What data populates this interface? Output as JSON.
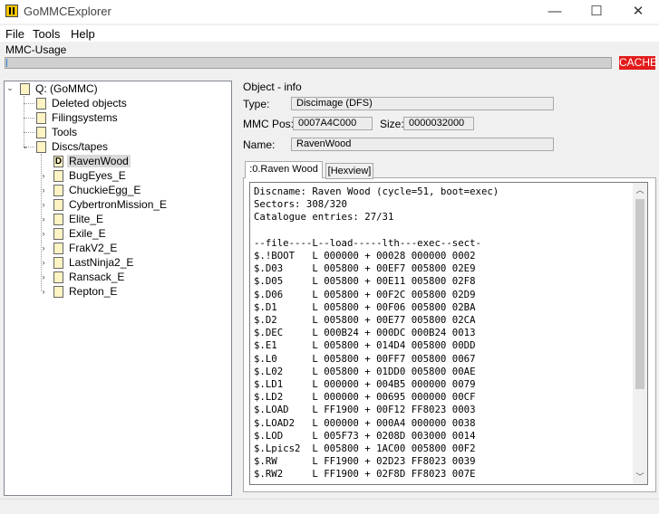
{
  "window": {
    "title": "GoMMCExplorer",
    "controls": [
      "—",
      "☐",
      "✕"
    ]
  },
  "menu": [
    "File",
    "Tools",
    "Help"
  ],
  "usage": {
    "label": "MMC-Usage",
    "fill_fraction": 0.002,
    "cache_label": "CACHE",
    "accent": "#2a7fd4",
    "cache_color": "#e21b1b"
  },
  "tree": {
    "root": "Q: (GoMMC)",
    "top_items": [
      "Deleted objects",
      "Filingsystems",
      "Tools",
      "Discs/tapes"
    ],
    "discs": [
      "RavenWood",
      "BugEyes_E",
      "ChuckieEgg_E",
      "CybertronMission_E",
      "Elite_E",
      "Exile_E",
      "FrakV2_E",
      "LastNinja2_E",
      "Ransack_E",
      "Repton_E"
    ],
    "selected_badge": "D"
  },
  "info": {
    "group_label": "Object - info",
    "type_label": "Type:",
    "type_value": "Discimage (DFS)",
    "pos_label": "MMC Pos:",
    "pos_value": "0007A4C000",
    "size_label": "Size:",
    "size_value": "0000032000",
    "name_label": "Name:",
    "name_value": "RavenWood"
  },
  "tabs": [
    ":0.Raven Wood",
    "[Hexview]"
  ],
  "catalogue": [
    "Discname: Raven Wood (cycle=51, boot=exec)",
    "Sectors: 308/320",
    "Catalogue entries: 27/31",
    "",
    "--file----L--load-----lth---exec--sect-",
    "$.!BOOT   L 000000 + 00028 000000 0002",
    "$.D03     L 005800 + 00EF7 005800 02E9",
    "$.D05     L 005800 + 00E11 005800 02F8",
    "$.D06     L 005800 + 00F2C 005800 02D9",
    "$.D1      L 005800 + 00F06 005800 02BA",
    "$.D2      L 005800 + 00E77 005800 02CA",
    "$.DEC     L 000B24 + 000DC 000B24 0013",
    "$.E1      L 005800 + 014D4 005800 00DD",
    "$.L0      L 005800 + 00FF7 005800 0067",
    "$.L02     L 005800 + 01DD0 005800 00AE",
    "$.LD1     L 000000 + 004B5 000000 0079",
    "$.LD2     L 000000 + 00695 000000 00CF",
    "$.LOAD    L FF1900 + 00F12 FF8023 0003",
    "$.LOAD2   L 000000 + 000A4 000000 0038",
    "$.LOD     L 005F73 + 0208D 003000 0014",
    "$.Lpics2  L 005800 + 1AC00 005800 00F2",
    "$.RW      L FF1900 + 02D23 FF8023 0039",
    "$.RW2     L FF1900 + 02F8D FF8023 007E"
  ]
}
